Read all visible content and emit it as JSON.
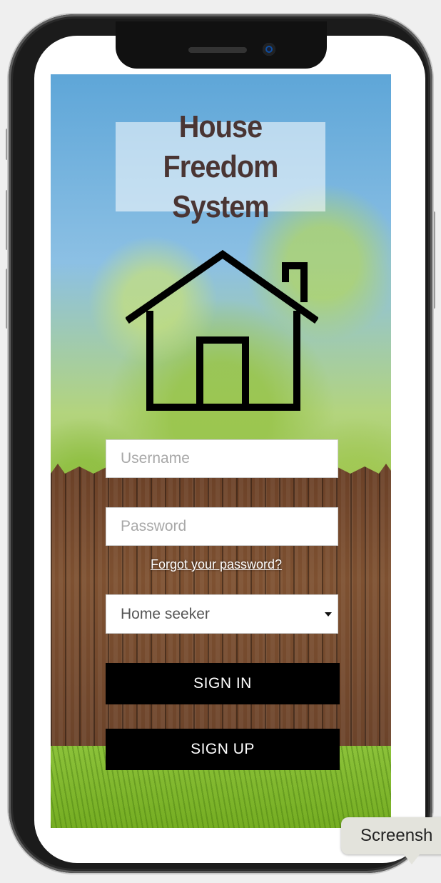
{
  "app": {
    "title_line1": "House Freedom",
    "title_line2": "System"
  },
  "login": {
    "username_placeholder": "Username",
    "password_placeholder": "Password",
    "forgot_label": "Forgot your password?",
    "role_selected": "Home seeker",
    "signin_label": "SIGN IN",
    "signup_label": "SIGN UP"
  },
  "icons": {
    "logo": "house-icon",
    "select_caret": "caret-down-icon"
  },
  "tooltip": {
    "text": "Screensh"
  },
  "colors": {
    "title": "#4a3533",
    "button_bg": "#000000",
    "button_text": "#ffffff"
  }
}
